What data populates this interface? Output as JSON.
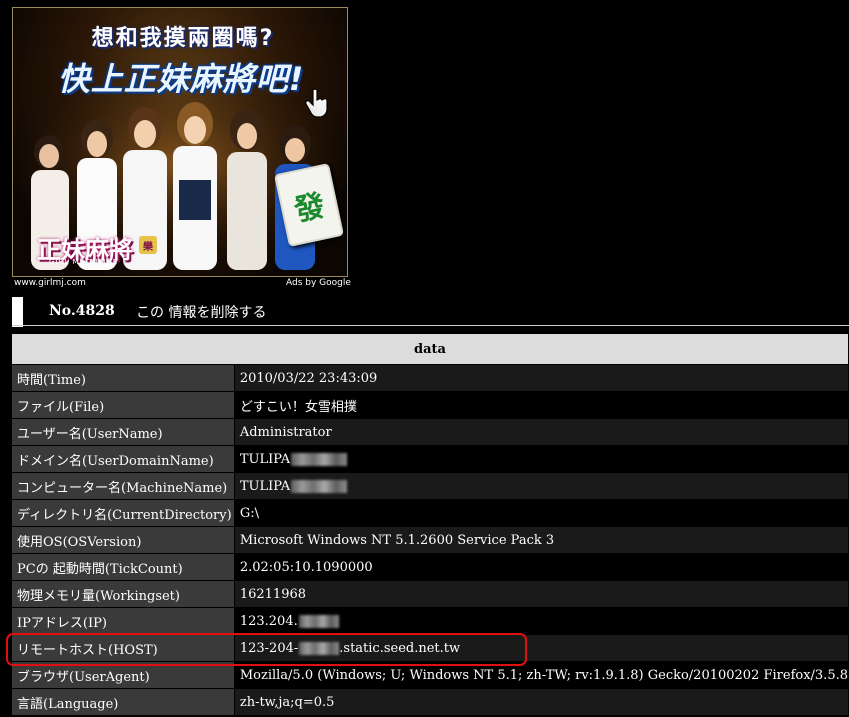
{
  "ad": {
    "headline": "想和我摸兩圈嗎?",
    "tagline": "快上正妹麻將吧!",
    "tile_glyph": "發",
    "logo_text": "正妹麻將",
    "logo_badge": "樂",
    "logo_sub": "GIRL MJ ONLINE",
    "url": "www.girlmj.com",
    "attribution": "Ads by Google",
    "colors": {
      "text_outline": "#0b3b8a",
      "logo_pink": "#b21a6b",
      "tile_green": "#1c8a2c"
    }
  },
  "header": {
    "number": "No.4828",
    "delete_link": "この 情報を削除する"
  },
  "table": {
    "header": "data",
    "rows": [
      {
        "label": "時間(Time)",
        "value": "2010/03/22 23:43:09"
      },
      {
        "label": "ファイル(File)",
        "value": "どすこい！女雪相撲"
      },
      {
        "label": "ユーザー名(UserName)",
        "value": "Administrator"
      },
      {
        "label": "ドメイン名(UserDomainName)",
        "value": "TULIPA"
      },
      {
        "label": "コンピューター名(MachineName)",
        "value": "TULIPA"
      },
      {
        "label": "ディレクトリ名(CurrentDirectory)",
        "value": "G:\\"
      },
      {
        "label": "使用OS(OSVersion)",
        "value": "Microsoft Windows NT 5.1.2600 Service Pack 3"
      },
      {
        "label": "PCの 起動時間(TickCount)",
        "value": "2.02:05:10.1090000"
      },
      {
        "label": "物理メモリ量(Workingset)",
        "value": "16211968"
      },
      {
        "label": "IPアドレス(IP)",
        "value": "123.204."
      },
      {
        "label": "リモートホスト(HOST)",
        "value_prefix": "123-204-",
        "value_suffix": ".static.seed.net.tw"
      },
      {
        "label": "ブラウザ(UserAgent)",
        "value": "Mozilla/5.0 (Windows; U; Windows NT 5.1; zh-TW; rv:1.9.1.8) Gecko/20100202 Firefox/3.5.8"
      },
      {
        "label": "言語(Language)",
        "value": "zh-tw,ja;q=0.5"
      }
    ],
    "highlighted_row": "リモートホスト(HOST)",
    "colors": {
      "label_bg": "#3a3a3a",
      "header_bg": "#dcdcdc",
      "highlight": "#e01010"
    }
  }
}
